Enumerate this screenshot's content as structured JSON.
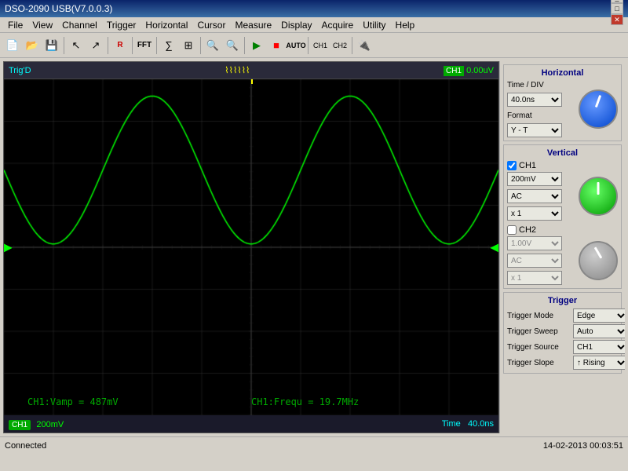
{
  "titlebar": {
    "title": "DSO-2090 USB(V7.0.0.3)"
  },
  "menubar": {
    "items": [
      "File",
      "View",
      "Channel",
      "Trigger",
      "Horizontal",
      "Cursor",
      "Measure",
      "Display",
      "Acquire",
      "Utility",
      "Help"
    ]
  },
  "scope_top": {
    "trig_label": "Trig'D",
    "ch1_voltage": "0.00uV"
  },
  "scope_bottom": {
    "ch1_label": "CH1",
    "volt_label": "200mV",
    "time_label": "Time",
    "time_value": "40.0ns"
  },
  "measurements": {
    "ch1_vamp": "CH1:Vamp = 487mV",
    "ch1_freq": "CH1:Frequ = 19.7MHz"
  },
  "horizontal": {
    "title": "Horizontal",
    "time_div_label": "Time / DIV",
    "time_div_value": "40.0ns",
    "format_label": "Format",
    "format_value": "Y - T"
  },
  "vertical": {
    "title": "Vertical",
    "ch1_checked": true,
    "ch1_label": "CH1",
    "ch1_voltage": "200mV",
    "ch1_coupling": "AC",
    "ch1_probe": "x 1",
    "ch2_checked": false,
    "ch2_label": "CH2",
    "ch2_voltage": "1.00V",
    "ch2_coupling": "AC",
    "ch2_probe": "x 1"
  },
  "trigger": {
    "title": "Trigger",
    "mode_label": "Trigger Mode",
    "mode_value": "Edge",
    "sweep_label": "Trigger Sweep",
    "sweep_value": "Auto",
    "source_label": "Trigger Source",
    "source_value": "CH1",
    "slope_label": "Trigger Slope",
    "slope_value": ""
  },
  "statusbar": {
    "connection": "Connected",
    "datetime": "14-02-2013 00:03:51"
  }
}
